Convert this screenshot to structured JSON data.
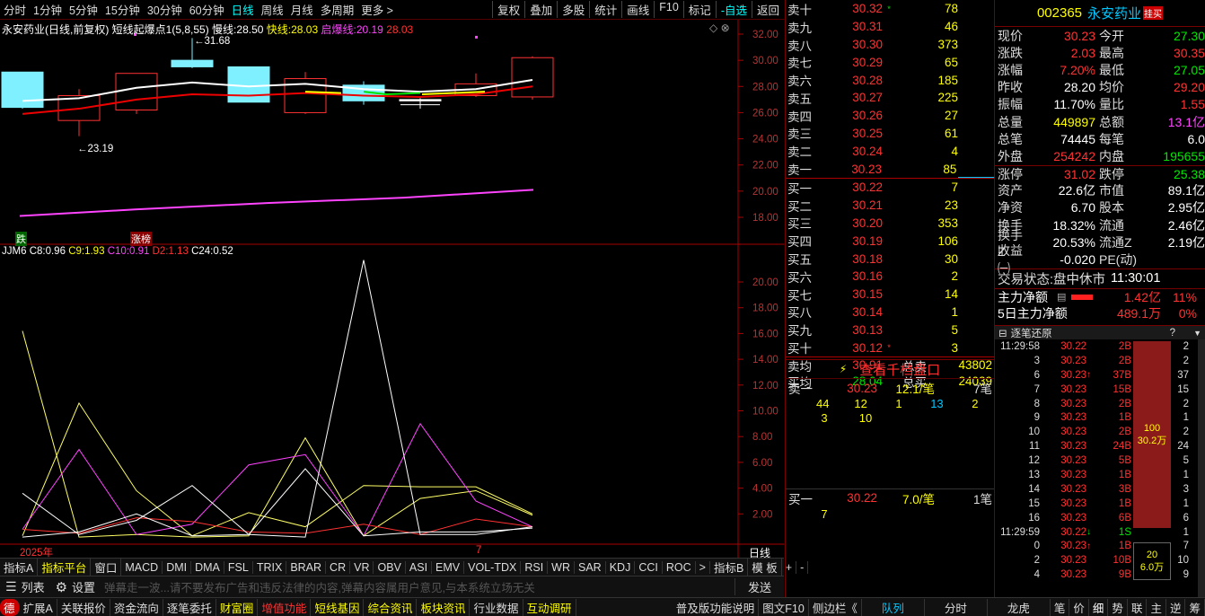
{
  "topbar": {
    "periods": [
      "分时",
      "1分钟",
      "5分钟",
      "15分钟",
      "30分钟",
      "60分钟",
      "日线",
      "周线",
      "月线",
      "多周期",
      "更多 >"
    ],
    "active_period": "日线",
    "tools": [
      "复权",
      "叠加",
      "多股",
      "统计",
      "画线",
      "F10",
      "标记",
      "-自选",
      "返回"
    ]
  },
  "main_chart": {
    "title": "永安药业(日线,前复权)",
    "indicator_name": "短线起爆点1(5,8,55)",
    "slow_label": "慢线:",
    "slow_value": "28.50",
    "fast_label": "快线:",
    "fast_value": "28.03",
    "launch_label": "启爆线:",
    "launch_value1": "20.19",
    "launch_value2": "28.03",
    "high_label": "31.68",
    "low_label": "23.19",
    "badge_fall": "跌",
    "badge_rise": "涨榜",
    "y_ticks": [
      "32.00",
      "30.00",
      "28.00",
      "26.00",
      "24.00",
      "22.00",
      "20.00",
      "18.00"
    ]
  },
  "sub_chart": {
    "name": "JJM6",
    "c8_label": "C8:",
    "c8_value": "0.96",
    "c9_label": "C9:",
    "c9_value": "1.93",
    "c10_label": "C10:",
    "c10_value": "0.91",
    "d2_label": "D2:",
    "d2_value": "1.13",
    "c24_label": "C24:",
    "c24_value": "0.52",
    "y_ticks": [
      "20.00",
      "18.00",
      "16.00",
      "14.00",
      "12.00",
      "10.00",
      "8.00",
      "6.00",
      "4.00",
      "2.00"
    ],
    "x_label_year": "2025年",
    "x_label_month": "7",
    "period_label": "日线"
  },
  "tabs": [
    "指标A",
    "指标平台",
    "窗口",
    "MACD",
    "DMI",
    "DMA",
    "FSL",
    "TRIX",
    "BRAR",
    "CR",
    "VR",
    "OBV",
    "ASI",
    "EMV",
    "VOL-TDX",
    "RSI",
    "WR",
    "SAR",
    "KDJ",
    "CCI",
    "ROC",
    ">",
    "指标B",
    "模 板",
    "+",
    "-"
  ],
  "bottom": {
    "list_label": "列表",
    "settings_label": "设置",
    "marquee": "弹幕走一波...请不要发布广告和违反法律的内容,弹幕内容属用户意见,与本系统立场无关",
    "send_label": "发送"
  },
  "bottom_tabs": [
    "德",
    "扩展A",
    "关联报价",
    "资金流向",
    "逐笔委托",
    "财富圈",
    "增值功能",
    "短线基因",
    "综合资讯",
    "板块资讯",
    "行业数据",
    "互动调研",
    "",
    "普及版功能说明",
    "图文F10",
    "侧边栏《",
    "队列",
    "分时",
    "龙虎",
    "笔",
    "价",
    "细",
    "势",
    "联",
    "主",
    "逆",
    "筹"
  ],
  "orderbook": {
    "asks": [
      {
        "label": "卖十",
        "price": "30.32",
        "mark": "*",
        "vol": "78"
      },
      {
        "label": "卖九",
        "price": "30.31",
        "mark": "",
        "vol": "46"
      },
      {
        "label": "卖八",
        "price": "30.30",
        "mark": "",
        "vol": "373"
      },
      {
        "label": "卖七",
        "price": "30.29",
        "mark": "",
        "vol": "65"
      },
      {
        "label": "卖六",
        "price": "30.28",
        "mark": "",
        "vol": "185"
      },
      {
        "label": "卖五",
        "price": "30.27",
        "mark": "",
        "vol": "225"
      },
      {
        "label": "卖四",
        "price": "30.26",
        "mark": "",
        "vol": "27"
      },
      {
        "label": "卖三",
        "price": "30.25",
        "mark": "",
        "vol": "61"
      },
      {
        "label": "卖二",
        "price": "30.24",
        "mark": "",
        "vol": "4"
      },
      {
        "label": "卖一",
        "price": "30.23",
        "mark": "",
        "vol": "85"
      }
    ],
    "bids": [
      {
        "label": "买一",
        "price": "30.22",
        "mark": "",
        "vol": "7"
      },
      {
        "label": "买二",
        "price": "30.21",
        "mark": "",
        "vol": "23"
      },
      {
        "label": "买三",
        "price": "30.20",
        "mark": "",
        "vol": "353"
      },
      {
        "label": "买四",
        "price": "30.19",
        "mark": "",
        "vol": "106"
      },
      {
        "label": "买五",
        "price": "30.18",
        "mark": "",
        "vol": "30"
      },
      {
        "label": "买六",
        "price": "30.16",
        "mark": "",
        "vol": "2"
      },
      {
        "label": "买七",
        "price": "30.15",
        "mark": "",
        "vol": "14"
      },
      {
        "label": "买八",
        "price": "30.14",
        "mark": "",
        "vol": "1"
      },
      {
        "label": "买九",
        "price": "30.13",
        "mark": "",
        "vol": "5"
      },
      {
        "label": "买十",
        "price": "30.12",
        "mark": "*",
        "vol": "3"
      }
    ],
    "avg_sell_label": "卖均",
    "avg_sell": "30.91",
    "total_sell_label": "总卖",
    "total_sell": "43802",
    "avg_buy_label": "买均",
    "avg_buy": "28.04",
    "total_buy_label": "总买",
    "total_buy": "24039",
    "depth_button": "查看千档盘口",
    "queue_sell_label": "卖一",
    "queue_sell_price": "30.23",
    "queue_sell_avg": "12.1/笔",
    "queue_sell_count": "7笔",
    "queue_sell_row1": [
      "44",
      "12",
      "1",
      "13",
      "2"
    ],
    "queue_sell_row2": [
      "3",
      "10"
    ],
    "queue_buy_label": "买一",
    "queue_buy_price": "30.22",
    "queue_buy_avg": "7.0/笔",
    "queue_buy_count": "1笔",
    "queue_buy_row1": [
      "7"
    ]
  },
  "info": {
    "code": "002365",
    "name": "永安药业",
    "badge": "挂买",
    "rows": [
      {
        "k": "现价",
        "v": "30.23",
        "vc": "red",
        "k2": "今开",
        "v2": "27.30",
        "v2c": "green"
      },
      {
        "k": "涨跌",
        "v": "2.03",
        "vc": "red",
        "k2": "最高",
        "v2": "30.35",
        "v2c": "red"
      },
      {
        "k": "涨幅",
        "v": "7.20%",
        "vc": "red",
        "k2": "最低",
        "v2": "27.05",
        "v2c": "green"
      },
      {
        "k": "昨收",
        "v": "28.20",
        "vc": "white",
        "k2": "均价",
        "v2": "29.20",
        "v2c": "red"
      },
      {
        "k": "振幅",
        "v": "11.70%",
        "vc": "white",
        "k2": "量比",
        "v2": "1.55",
        "v2c": "red"
      },
      {
        "k": "总量",
        "v": "449897",
        "vc": "yellow",
        "k2": "总额",
        "v2": "13.1亿",
        "v2c": "mag"
      },
      {
        "k": "总笔",
        "v": "74445",
        "vc": "white",
        "k2": "每笔",
        "v2": "6.0",
        "v2c": "white"
      },
      {
        "k": "外盘",
        "v": "254242",
        "vc": "red",
        "k2": "内盘",
        "v2": "195655",
        "v2c": "green"
      },
      {
        "k": "涨停",
        "v": "31.02",
        "vc": "red",
        "k2": "跌停",
        "v2": "25.38",
        "v2c": "green"
      },
      {
        "k": "资产",
        "v": "22.6亿",
        "vc": "white",
        "k2": "市值",
        "v2": "89.1亿",
        "v2c": "white"
      },
      {
        "k": "净资",
        "v": "6.70",
        "vc": "white",
        "k2": "股本",
        "v2": "2.95亿",
        "v2c": "white"
      },
      {
        "k": "换手",
        "v": "18.32%",
        "vc": "white",
        "k2": "流通",
        "v2": "2.46亿",
        "v2c": "white"
      },
      {
        "k": "换手Z",
        "v": "20.53%",
        "vc": "white",
        "k2": "流通Z",
        "v2": "2.19亿",
        "v2c": "white"
      },
      {
        "k": "收益㈠",
        "v": "-0.020",
        "vc": "white",
        "k2": "PE(动)",
        "v2": "",
        "v2c": "white"
      }
    ],
    "status_label": "交易状态:",
    "status_value": "盘中休市",
    "status_time": "11:30:01",
    "main_net_label": "主力净额",
    "main_net_value": "1.42亿",
    "main_net_pct": "11%",
    "main5_label": "5日主力净额",
    "main5_value": "489.1万",
    "main5_pct": "0%"
  },
  "ticks": {
    "title": "逐笔还原",
    "question": "?",
    "rows": [
      {
        "t": "11:29:58",
        "p": "30.22",
        "arrow": "",
        "v": "2B",
        "vc": "red",
        "n": "2"
      },
      {
        "t": "3",
        "p": "30.23",
        "arrow": "",
        "v": "2B",
        "vc": "red",
        "n": "2"
      },
      {
        "t": "6",
        "p": "30.23",
        "arrow": "↑",
        "v": "37B",
        "vc": "red",
        "n": "37"
      },
      {
        "t": "7",
        "p": "30.23",
        "arrow": "",
        "v": "15B",
        "vc": "red",
        "n": "15"
      },
      {
        "t": "8",
        "p": "30.23",
        "arrow": "",
        "v": "2B",
        "vc": "red",
        "n": "2"
      },
      {
        "t": "9",
        "p": "30.23",
        "arrow": "",
        "v": "1B",
        "vc": "red",
        "n": "1"
      },
      {
        "t": "10",
        "p": "30.23",
        "arrow": "",
        "v": "2B",
        "vc": "red",
        "n": "2"
      },
      {
        "t": "11",
        "p": "30.23",
        "arrow": "",
        "v": "24B",
        "vc": "red",
        "n": "24"
      },
      {
        "t": "12",
        "p": "30.23",
        "arrow": "",
        "v": "5B",
        "vc": "red",
        "n": "5"
      },
      {
        "t": "13",
        "p": "30.23",
        "arrow": "",
        "v": "1B",
        "vc": "red",
        "n": "1"
      },
      {
        "t": "14",
        "p": "30.23",
        "arrow": "",
        "v": "3B",
        "vc": "red",
        "n": "3"
      },
      {
        "t": "15",
        "p": "30.23",
        "arrow": "",
        "v": "1B",
        "vc": "red",
        "n": "1"
      },
      {
        "t": "16",
        "p": "30.23",
        "arrow": "",
        "v": "6B",
        "vc": "red",
        "n": "6"
      },
      {
        "t": "11:29:59",
        "p": "30.22",
        "arrow": "↓",
        "v": "1S",
        "vc": "green",
        "n": "1"
      },
      {
        "t": "0",
        "p": "30.23",
        "arrow": "↑",
        "v": "1B",
        "vc": "red",
        "n": "7"
      },
      {
        "t": "2",
        "p": "30.23",
        "arrow": "",
        "v": "10B",
        "vc": "red",
        "n": "10"
      },
      {
        "t": "4",
        "p": "30.23",
        "arrow": "",
        "v": "9B",
        "vc": "red",
        "n": "9"
      }
    ],
    "bar1_count": "100",
    "bar1_amount": "30.2万",
    "bar2_count": "20",
    "bar2_amount": "6.0万"
  }
}
